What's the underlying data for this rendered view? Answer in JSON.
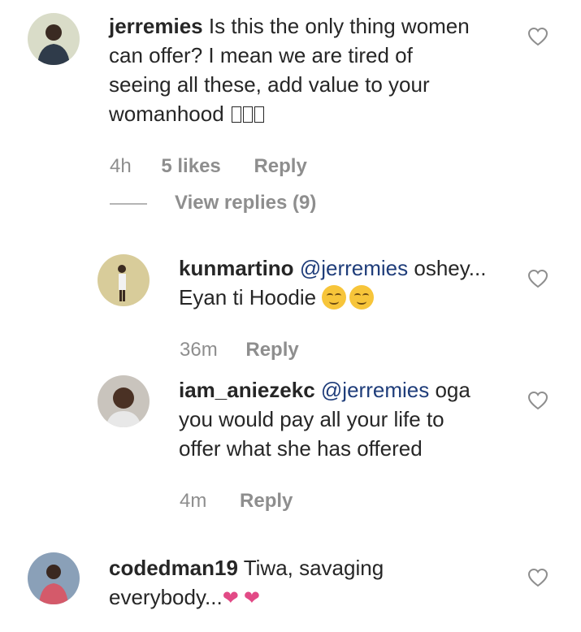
{
  "comments": [
    {
      "username": "jerremies",
      "text_lines": [
        "Is this the only thing women",
        "can offer? I mean we are tired of",
        "seeing all these, add value to your",
        "womanhood"
      ],
      "time": "4h",
      "likes": "5 likes",
      "reply": "Reply",
      "view_replies": "View replies (9)"
    },
    {
      "username": "kunmartino",
      "mention": "@jerremies",
      "text_lines": [
        "oshey...",
        "Eyan ti Hoodie"
      ],
      "time": "36m",
      "reply": "Reply"
    },
    {
      "username": "iam_aniezekc",
      "mention": "@jerremies",
      "text_lines": [
        "oga",
        "you would pay all your life to",
        "offer what she has offered"
      ],
      "time": "4m",
      "reply": "Reply"
    },
    {
      "username": "codedman19",
      "text_lines": [
        "Tiwa, savaging",
        "everybody..."
      ]
    }
  ],
  "icons": {
    "like": "heart-outline-icon",
    "pink_heart": "pink-heart-emoji",
    "smile": "smiling-face-emoji"
  },
  "colors": {
    "text": "#262626",
    "meta": "#8e8e8e",
    "mention": "#1f3d7a",
    "pink": "#e24a86"
  }
}
